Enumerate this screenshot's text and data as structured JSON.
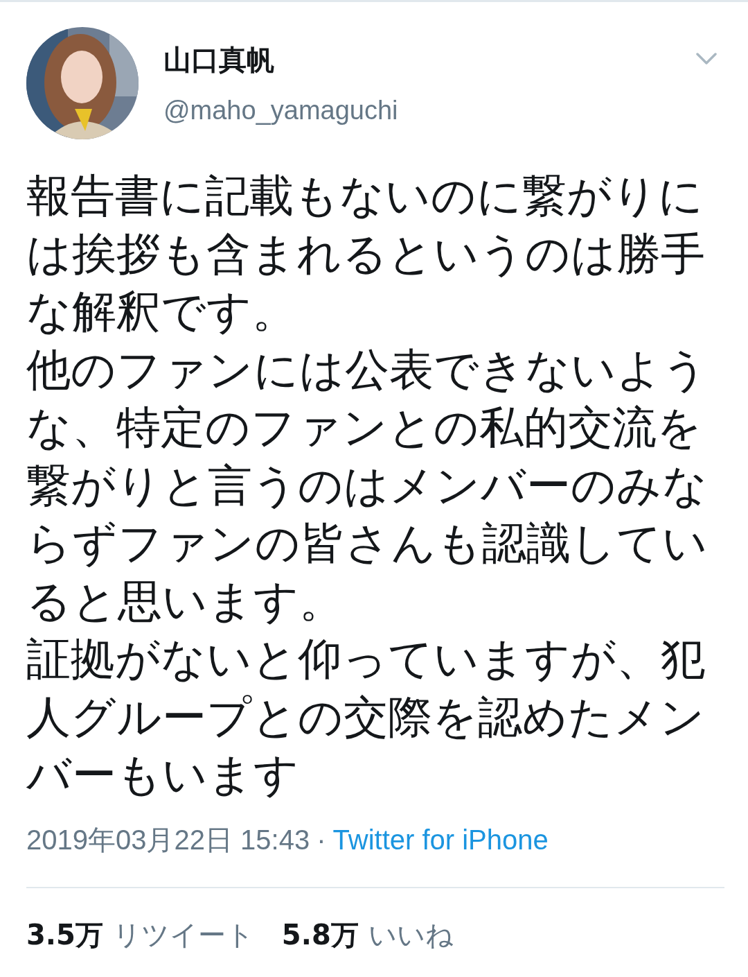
{
  "author": {
    "name": "山口真帆",
    "handle": "@maho_yamaguchi"
  },
  "tweet": {
    "paragraphs": [
      "報告書に記載もないのに繋がりには挨拶も含まれるというのは勝手な解釈です。",
      "他のファンには公表できないような、特定のファンとの私的交流を繋がりと言うのはメンバーのみならずファンの皆さんも認識していると思います。",
      "証拠がないと仰っていますが、犯人グループとの交際を認めたメンバーもいます"
    ]
  },
  "meta": {
    "timestamp": "2019年03月22日 15:43",
    "separator": "·",
    "source": "Twitter for iPhone"
  },
  "stats": [
    {
      "count": "3.5万",
      "label": "リツイート"
    },
    {
      "count": "5.8万",
      "label": "いいね"
    }
  ]
}
